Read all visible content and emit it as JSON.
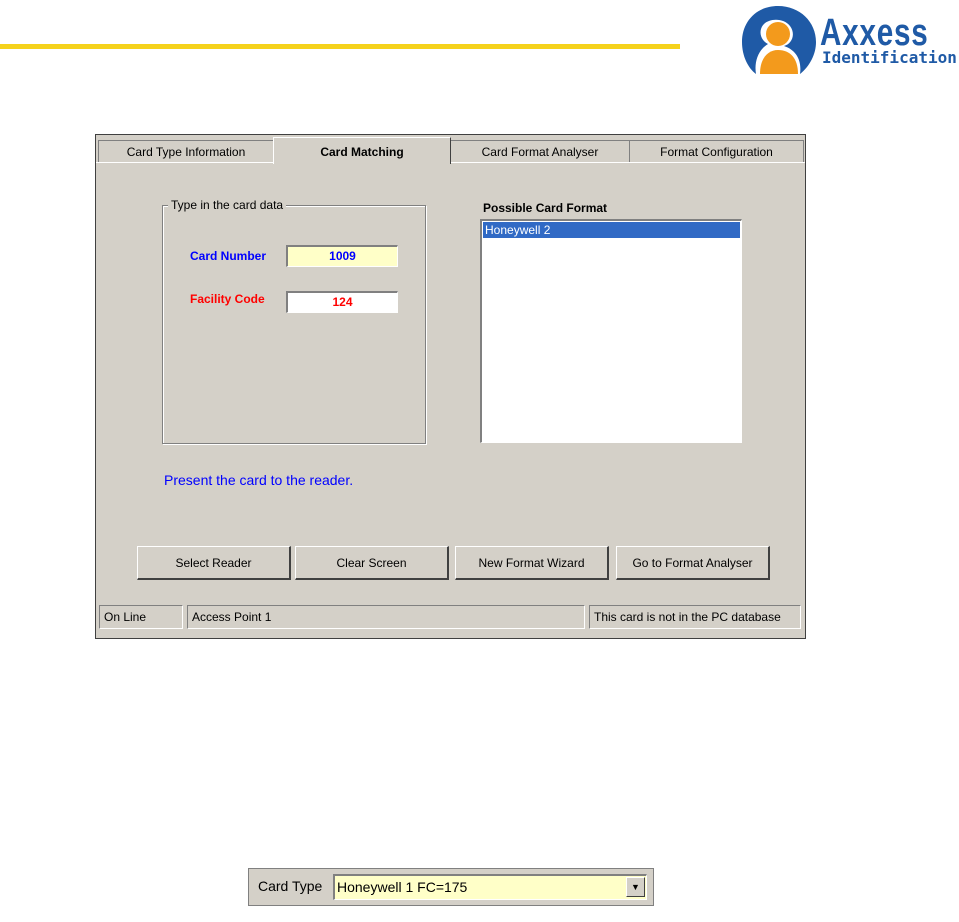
{
  "logo": {
    "word": "Axxess",
    "sub": "Identification"
  },
  "tabs": [
    {
      "label": "Card Type Information"
    },
    {
      "label": "Card Matching",
      "active": true
    },
    {
      "label": "Card Format Analyser"
    },
    {
      "label": "Format Configuration"
    }
  ],
  "group": {
    "title": "Type in the card data",
    "card_number_label": "Card Number",
    "card_number_value": "1009",
    "facility_code_label": "Facility Code",
    "facility_code_value": "124"
  },
  "possible": {
    "title": "Possible Card Format",
    "items": [
      "Honeywell 2"
    ]
  },
  "message": "Present the card to the reader.",
  "buttons": {
    "select_reader": "Select Reader",
    "clear_screen": "Clear Screen",
    "new_format_wizard": "New Format Wizard",
    "go_to_format_analyser": "Go to Format Analyser"
  },
  "status": {
    "connection": "On Line",
    "access_point": "Access Point 1",
    "database": "This card is not in the PC database"
  },
  "card_type": {
    "label": "Card Type",
    "value": "Honeywell 1 FC=175"
  },
  "colors": {
    "accent_yellow": "#f5d21c",
    "logo_blue": "#1f5aa6",
    "logo_orange": "#f39a1c",
    "selection": "#316ac5"
  }
}
